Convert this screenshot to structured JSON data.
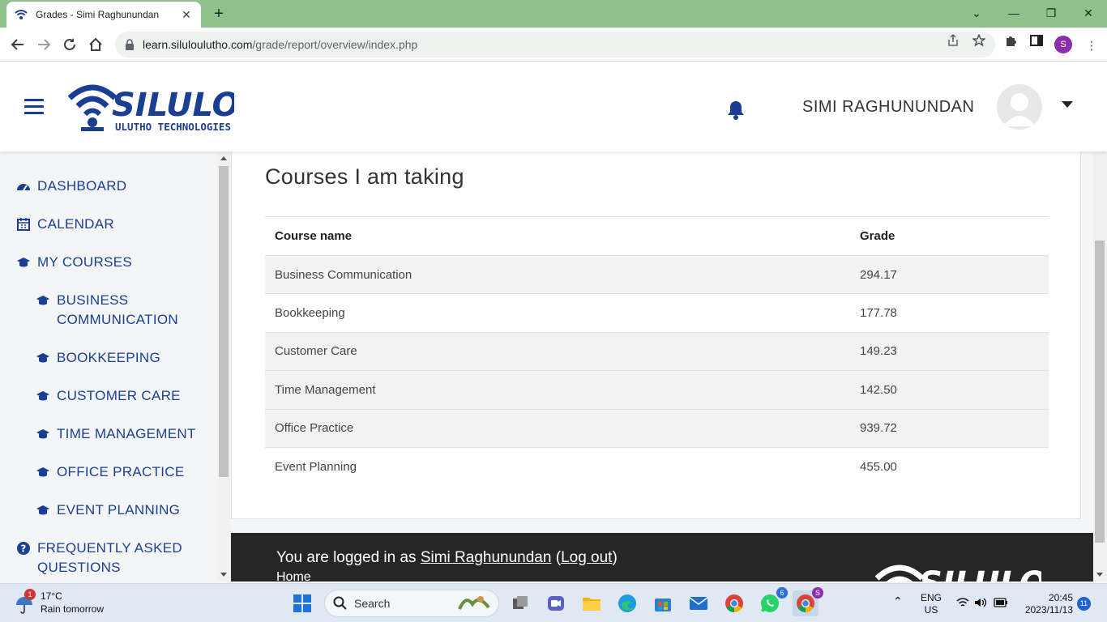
{
  "browser": {
    "tab_title": "Grades - Simi Raghunundan",
    "url_host": "learn.siluloulutho.com",
    "url_path": "/grade/report/overview/index.php",
    "profile_initial": "S"
  },
  "header": {
    "logo_main": "SILULO",
    "logo_sub": "ULUTHO TECHNOLOGIES",
    "user_name": "SIMI RAGHUNUNDAN"
  },
  "sidebar": {
    "items": [
      {
        "label": "DASHBOARD",
        "icon": "dashboard-icon"
      },
      {
        "label": "CALENDAR",
        "icon": "calendar-icon"
      },
      {
        "label": "MY COURSES",
        "icon": "graduation-cap-icon"
      },
      {
        "label": "BUSINESS COMMUNICATION",
        "icon": "graduation-cap-icon"
      },
      {
        "label": "BOOKKEEPING",
        "icon": "graduation-cap-icon"
      },
      {
        "label": "CUSTOMER CARE",
        "icon": "graduation-cap-icon"
      },
      {
        "label": "TIME MANAGEMENT",
        "icon": "graduation-cap-icon"
      },
      {
        "label": "OFFICE PRACTICE",
        "icon": "graduation-cap-icon"
      },
      {
        "label": "EVENT PLANNING",
        "icon": "graduation-cap-icon"
      },
      {
        "label": "FREQUENTLY ASKED QUESTIONS",
        "icon": "question-circle-icon"
      }
    ]
  },
  "main": {
    "heading": "Courses I am taking",
    "table": {
      "headers": [
        "Course name",
        "Grade"
      ],
      "rows": [
        [
          "Business Communication",
          "294.17"
        ],
        [
          "Bookkeeping",
          "177.78"
        ],
        [
          "Customer Care",
          "149.23"
        ],
        [
          "Time Management",
          "142.50"
        ],
        [
          "Office Practice",
          "939.72"
        ],
        [
          "Event Planning",
          "455.00"
        ]
      ]
    }
  },
  "footer": {
    "logged_prefix": "You are logged in as ",
    "user_link": "Simi Raghunundan",
    "logout_open": " (",
    "logout_link": "Log out",
    "logout_close": ")",
    "home_link": "Home"
  },
  "taskbar": {
    "weather_temp": "17°C",
    "weather_text": "Rain tomorrow",
    "weather_badge": "1",
    "search_label": "Search",
    "whatsapp_badge": "6",
    "chrome_badge": "S",
    "lang_1": "ENG",
    "lang_2": "US",
    "time": "20:45",
    "date": "2023/11/13",
    "notification_count": "11"
  },
  "colors": {
    "brand_blue": "#1a3f92",
    "tab_strip": "#8fc28a",
    "footer_bg": "#262626"
  }
}
